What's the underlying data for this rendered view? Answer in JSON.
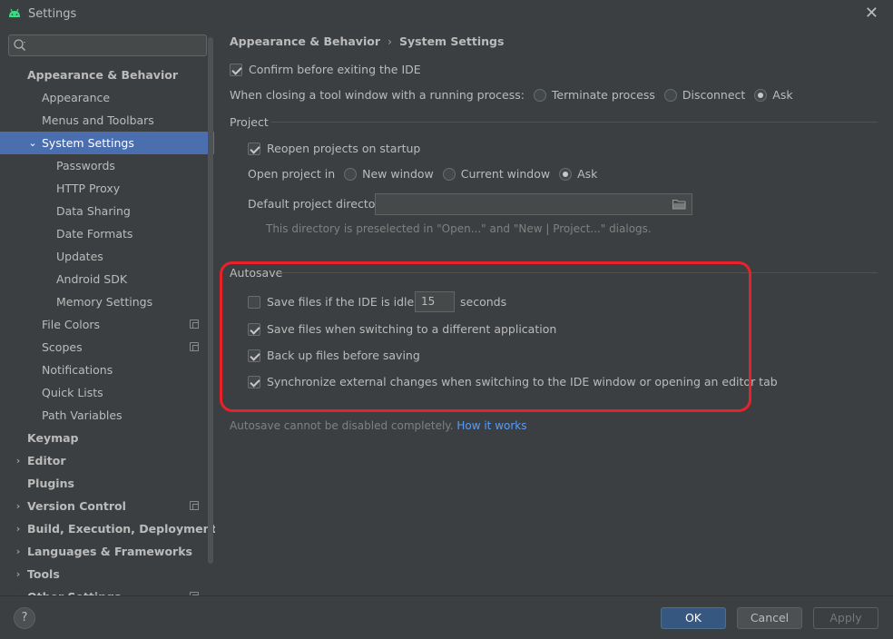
{
  "window": {
    "title": "Settings",
    "close_glyph": "✕",
    "icon": "android-icon"
  },
  "search": {
    "placeholder": "",
    "value": ""
  },
  "sidebar": {
    "items": [
      {
        "label": "Appearance & Behavior",
        "bold": true,
        "indent": 0,
        "arrow": ""
      },
      {
        "label": "Appearance",
        "bold": false,
        "indent": 1
      },
      {
        "label": "Menus and Toolbars",
        "bold": false,
        "indent": 1
      },
      {
        "label": "System Settings",
        "bold": false,
        "indent": 1,
        "arrow": "⌄",
        "selected": true
      },
      {
        "label": "Passwords",
        "bold": false,
        "indent": 2
      },
      {
        "label": "HTTP Proxy",
        "bold": false,
        "indent": 2
      },
      {
        "label": "Data Sharing",
        "bold": false,
        "indent": 2
      },
      {
        "label": "Date Formats",
        "bold": false,
        "indent": 2
      },
      {
        "label": "Updates",
        "bold": false,
        "indent": 2
      },
      {
        "label": "Android SDK",
        "bold": false,
        "indent": 2
      },
      {
        "label": "Memory Settings",
        "bold": false,
        "indent": 2
      },
      {
        "label": "File Colors",
        "bold": false,
        "indent": 1,
        "proj": true
      },
      {
        "label": "Scopes",
        "bold": false,
        "indent": 1,
        "proj": true
      },
      {
        "label": "Notifications",
        "bold": false,
        "indent": 1
      },
      {
        "label": "Quick Lists",
        "bold": false,
        "indent": 1
      },
      {
        "label": "Path Variables",
        "bold": false,
        "indent": 1
      },
      {
        "label": "Keymap",
        "bold": true,
        "indent": 0
      },
      {
        "label": "Editor",
        "bold": true,
        "indent": 0,
        "arrow": "›"
      },
      {
        "label": "Plugins",
        "bold": true,
        "indent": 0
      },
      {
        "label": "Version Control",
        "bold": true,
        "indent": 0,
        "arrow": "›",
        "proj": true
      },
      {
        "label": "Build, Execution, Deployment",
        "bold": true,
        "indent": 0,
        "arrow": "›"
      },
      {
        "label": "Languages & Frameworks",
        "bold": true,
        "indent": 0,
        "arrow": "›"
      },
      {
        "label": "Tools",
        "bold": true,
        "indent": 0,
        "arrow": "›"
      },
      {
        "label": "Other Settings",
        "bold": true,
        "indent": 0,
        "arrow": "›",
        "proj": true
      }
    ]
  },
  "breadcrumb": {
    "parent": "Appearance & Behavior",
    "separator": "›",
    "current": "System Settings"
  },
  "general": {
    "confirm_exit": {
      "label": "Confirm before exiting the IDE",
      "checked": true
    },
    "tool_window": {
      "label": "When closing a tool window with a running process:",
      "options": [
        {
          "label": "Terminate process",
          "selected": false
        },
        {
          "label": "Disconnect",
          "selected": false
        },
        {
          "label": "Ask",
          "selected": true
        }
      ]
    }
  },
  "project": {
    "title": "Project",
    "reopen": {
      "label": "Reopen projects on startup",
      "checked": true
    },
    "open_in": {
      "label": "Open project in",
      "options": [
        {
          "label": "New window",
          "selected": false
        },
        {
          "label": "Current window",
          "selected": false
        },
        {
          "label": "Ask",
          "selected": true
        }
      ]
    },
    "default_dir": {
      "label": "Default project directory:",
      "value": "",
      "icon": "folder-icon"
    },
    "hint": "This directory is preselected in \"Open...\" and \"New | Project...\" dialogs."
  },
  "autosave": {
    "title": "Autosave",
    "idle": {
      "label_before": "Save files if the IDE is idle for",
      "value": "15",
      "label_after": "seconds",
      "checked": false
    },
    "switch_app": {
      "label": "Save files when switching to a different application",
      "checked": true
    },
    "backup": {
      "label": "Back up files before saving",
      "checked": true
    },
    "sync": {
      "label": "Synchronize external changes when switching to the IDE window or opening an editor tab",
      "checked": true
    },
    "note": "Autosave cannot be disabled completely.",
    "link": "How it works",
    "highlight_color": "#e8212b"
  },
  "footer": {
    "help": "?",
    "ok": "OK",
    "cancel": "Cancel",
    "apply": "Apply"
  },
  "colors": {
    "selection": "#4b6eaf",
    "primary_button": "#365880",
    "link": "#589df6"
  }
}
